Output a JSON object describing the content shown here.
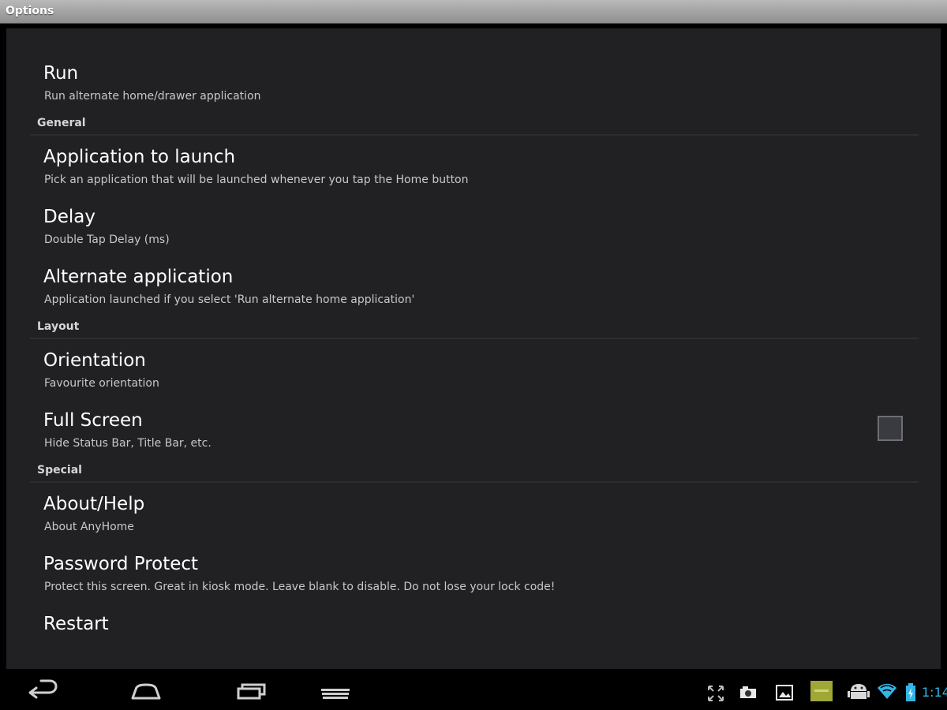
{
  "window": {
    "title": "Options"
  },
  "sections": [
    {
      "title": "General"
    },
    {
      "title": "Layout"
    },
    {
      "title": "Special"
    }
  ],
  "preferences": [
    {
      "title": "Run",
      "summary": "Run alternate home/drawer application"
    },
    {
      "title": "Application to launch",
      "summary": "Pick an application that will be launched whenever you tap the Home button"
    },
    {
      "title": "Delay",
      "summary": "Double Tap Delay (ms)"
    },
    {
      "title": "Alternate application",
      "summary": "Application launched if you select 'Run alternate home application'"
    },
    {
      "title": "Orientation",
      "summary": "Favourite orientation"
    },
    {
      "title": "Full Screen",
      "summary": "Hide Status Bar, Title Bar, etc.",
      "checked": false
    },
    {
      "title": "About/Help",
      "summary": "About AnyHome"
    },
    {
      "title": "Password Protect",
      "summary": "Protect this screen. Great in kiosk mode. Leave blank to disable. Do not lose your lock code!"
    },
    {
      "title": "Restart",
      "summary": ""
    }
  ],
  "navigation": {
    "buttons": [
      "back-icon",
      "home-icon",
      "recent-apps-icon",
      "menu-icon"
    ]
  },
  "status": {
    "icons": [
      "fullscreen-icon",
      "camera-icon",
      "gallery-icon",
      "app-notification-icon",
      "android-icon",
      "wifi-icon",
      "battery-icon"
    ],
    "time": "1:14",
    "accent_color": "#33b5e5"
  }
}
